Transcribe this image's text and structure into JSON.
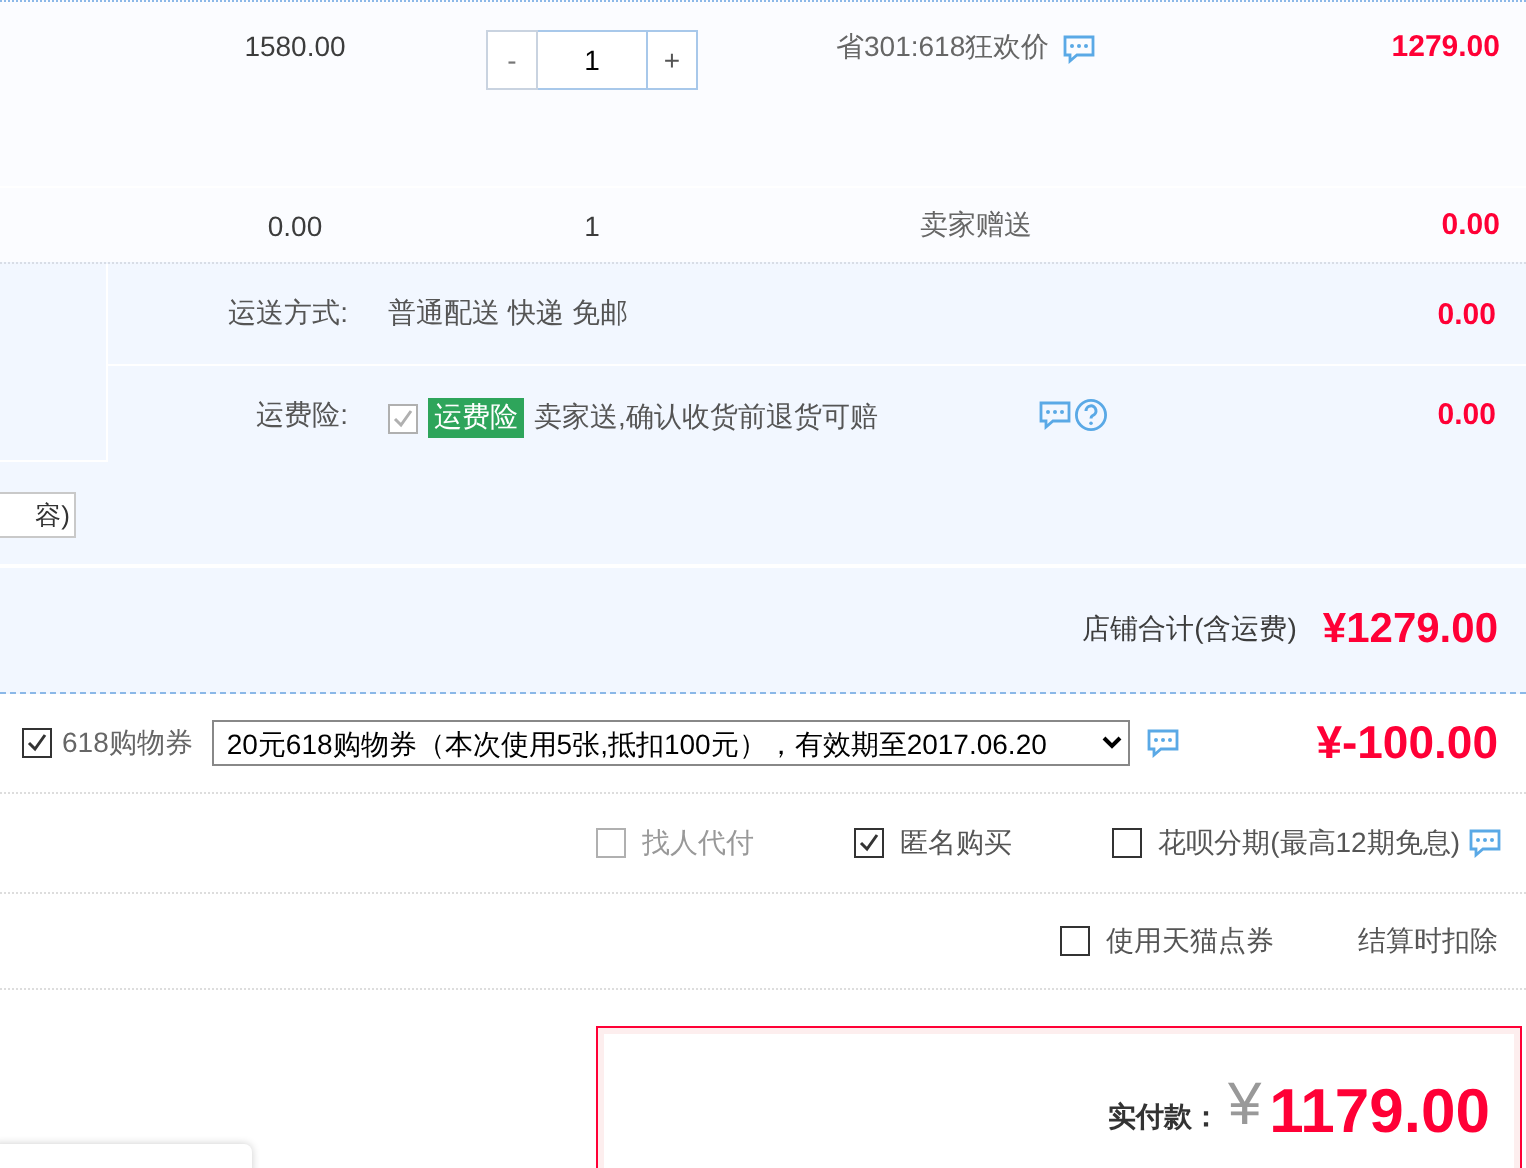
{
  "item": {
    "unit_price": "1580.00",
    "quantity": {
      "minus": "-",
      "value": "1",
      "plus": "+"
    },
    "promotion": "省301:618狂欢价",
    "subtotal": "1279.00"
  },
  "gift": {
    "unit_price": "0.00",
    "quantity": "1",
    "promotion": "卖家赠送",
    "subtotal": "0.00"
  },
  "shipping": {
    "label": "运送方式:",
    "value": "普通配送 快递 免邮",
    "cost": "0.00"
  },
  "insurance": {
    "label": "运费险:",
    "checked": true,
    "disabled": true,
    "tag": "运费险",
    "description": "卖家送,确认收货前退货可赔",
    "cost": "0.00"
  },
  "message_field": {
    "value": "容)"
  },
  "store_total": {
    "label": "店铺合计(含运费)",
    "amount": "¥1279.00"
  },
  "coupon": {
    "checked": true,
    "label": "618购物券",
    "selection": "20元618购物券（本次使用5张,抵扣100元），有效期至2017.06.20",
    "amount": "¥-100.00"
  },
  "options": [
    {
      "label": "找人代付",
      "checked": false,
      "disabled": true,
      "chat_icon": false
    },
    {
      "label": "匿名购买",
      "checked": true,
      "disabled": false,
      "chat_icon": false
    },
    {
      "label": "花呗分期(最高12期免息)",
      "checked": false,
      "disabled": false,
      "chat_icon": true
    }
  ],
  "points": {
    "checked": false,
    "label": "使用天猫点券",
    "note": "结算时扣除"
  },
  "payment": {
    "label": "实付款：",
    "currency": "¥",
    "amount": "1179.00"
  }
}
